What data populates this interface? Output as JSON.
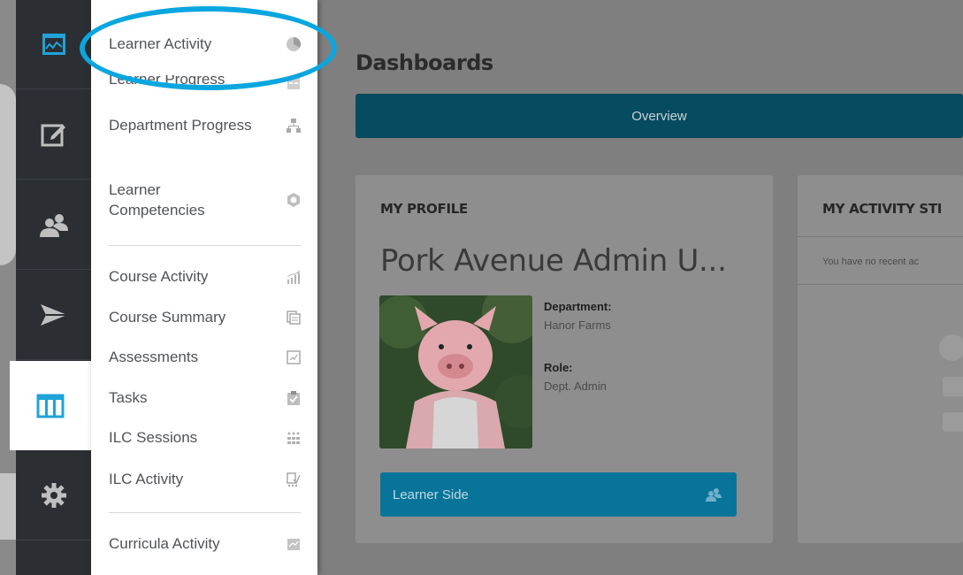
{
  "menu": {
    "items": [
      {
        "label": "Learner Activity",
        "icon": "pie-chart-icon"
      },
      {
        "label": "Learner Progress",
        "icon": "progress-report-icon"
      },
      {
        "label": "Department Progress",
        "icon": "org-chart-icon"
      },
      {
        "label": "Learner Competencies",
        "icon": "badge-icon"
      },
      {
        "label": "Course Activity",
        "icon": "bar-chart-icon"
      },
      {
        "label": "Course Summary",
        "icon": "documents-icon"
      },
      {
        "label": "Assessments",
        "icon": "assessment-icon"
      },
      {
        "label": "Tasks",
        "icon": "clipboard-check-icon"
      },
      {
        "label": "ILC Sessions",
        "icon": "sessions-grid-icon"
      },
      {
        "label": "ILC Activity",
        "icon": "activity-checklist-icon"
      },
      {
        "label": "Curricula Activity",
        "icon": "curricula-icon"
      }
    ]
  },
  "rail": [
    "dashboard-icon",
    "edit-icon",
    "users-icon",
    "paper-plane-icon",
    "reports-icon",
    "settings-gear-icon"
  ],
  "main": {
    "title": "Dashboards",
    "overview_tab": "Overview",
    "profile": {
      "heading": "MY PROFILE",
      "name": "Pork Avenue Admin U...",
      "department_label": "Department:",
      "department_value": "Hanor Farms",
      "role_label": "Role:",
      "role_value": "Dept. Admin",
      "button_label": "Learner Side"
    },
    "activity": {
      "heading": "MY ACTIVITY STI",
      "empty_text": "You have no recent ac"
    }
  },
  "colors": {
    "accent": "#0aa6df",
    "rail_bg": "#2b2f33",
    "overview_bg": "#074b60",
    "button_bg": "#08749a"
  }
}
